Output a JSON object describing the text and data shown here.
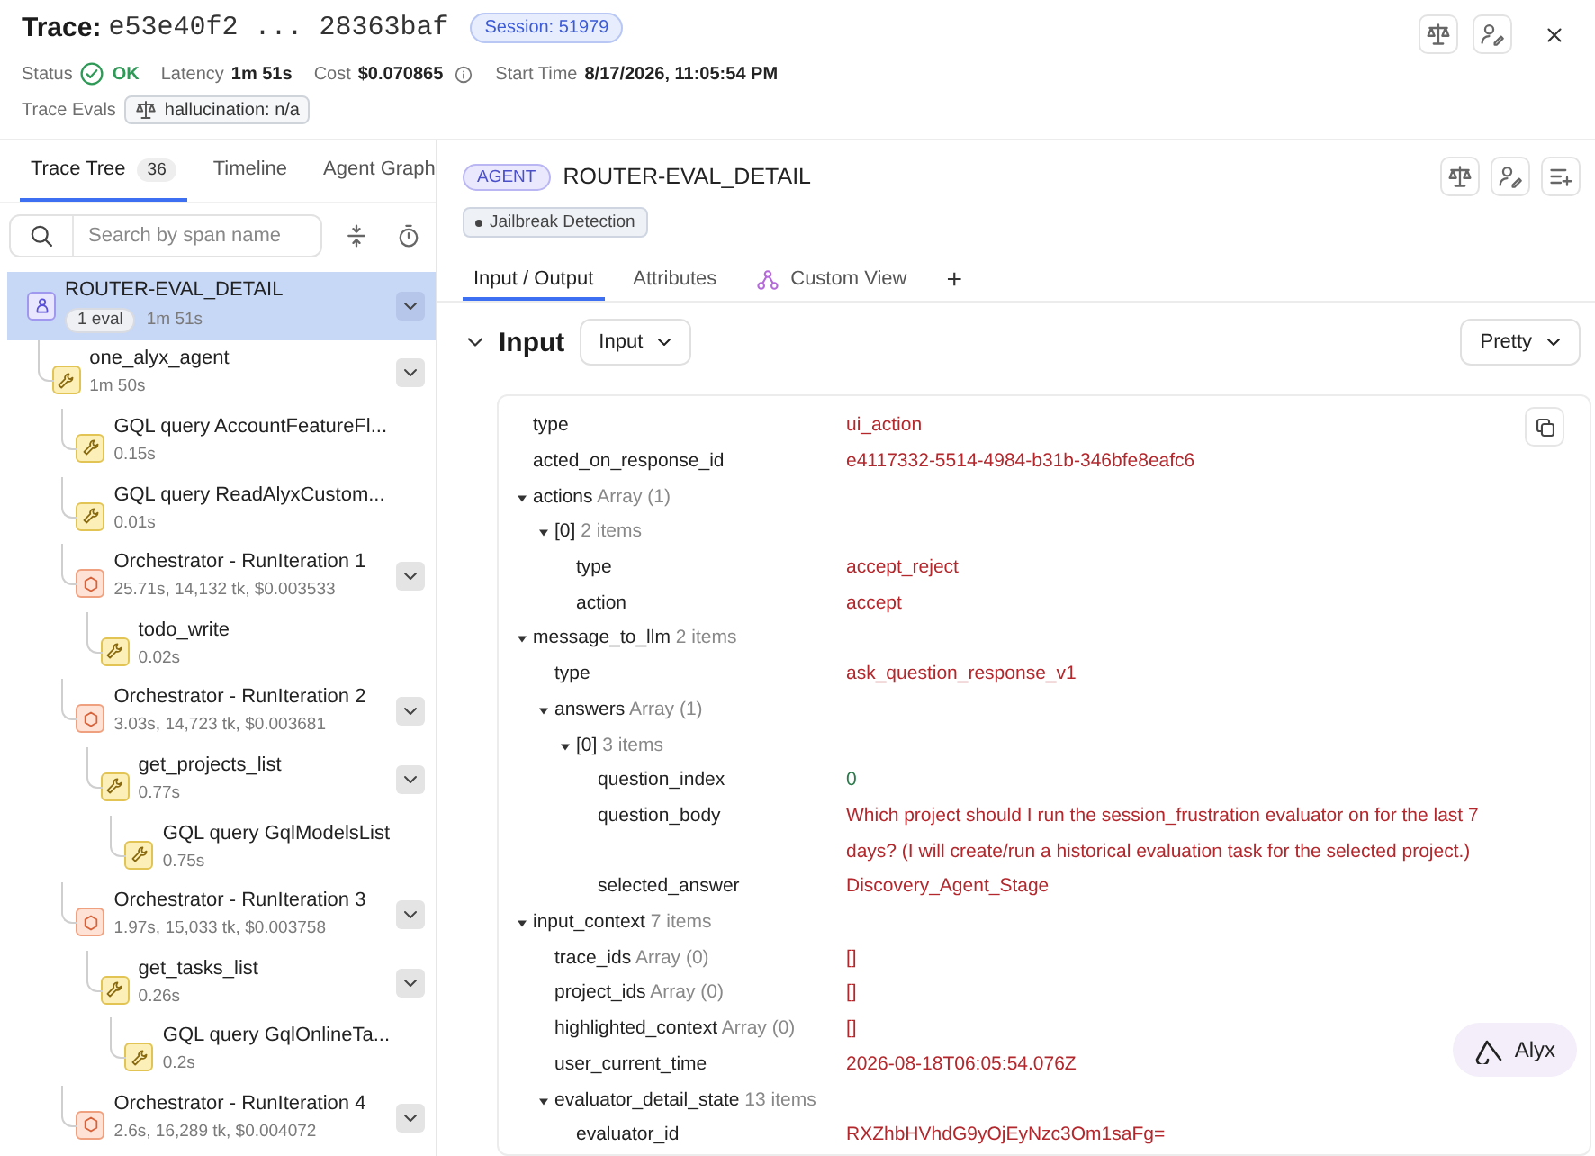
{
  "header": {
    "title_label": "Trace:",
    "trace_id": "e53e40f2 ... 28363baf",
    "session_badge": "Session: 51979",
    "stats": [
      {
        "label": "Status",
        "value": "OK",
        "kind": "status"
      },
      {
        "label": "Latency",
        "value": "1m 51s",
        "kind": "plain"
      },
      {
        "label": "Cost",
        "value": "$0.070865",
        "kind": "info"
      },
      {
        "label": "Start Time",
        "value": "8/17/2026, 11:05:54 PM",
        "kind": "plain"
      }
    ],
    "evals_label": "Trace Evals",
    "eval_badge": "hallucination: n/a"
  },
  "left_panel": {
    "tabs": [
      {
        "label": "Trace Tree",
        "count": "36",
        "selected": true
      },
      {
        "label": "Timeline",
        "selected": false
      },
      {
        "label": "Agent Graph",
        "selected": false
      }
    ],
    "search": {
      "placeholder": "Search by span name"
    },
    "tree": [
      {
        "kind": "agent",
        "name": "ROUTER-EVAL_DETAIL",
        "badge": "1 eval",
        "meta": "1m 51s",
        "selected": true,
        "expanded": true,
        "children": [
          {
            "kind": "tool",
            "name": "one_alyx_agent",
            "meta": "1m 50s",
            "selected": false,
            "expanded": true,
            "children": [
              {
                "kind": "tool",
                "name": "GQL query AccountFeatureFl...",
                "meta": "0.15s",
                "selected": false
              },
              {
                "kind": "tool",
                "name": "GQL query ReadAlyxCustom...",
                "meta": "0.01s",
                "selected": false
              },
              {
                "kind": "chain",
                "name": "Orchestrator - RunIteration 1",
                "meta": "25.71s, 14,132 tk, $0.003533",
                "selected": false,
                "expanded": true,
                "children": [
                  {
                    "kind": "tool",
                    "name": "todo_write",
                    "meta": "0.02s",
                    "selected": false
                  }
                ]
              },
              {
                "kind": "chain",
                "name": "Orchestrator - RunIteration 2",
                "meta": "3.03s, 14,723 tk, $0.003681",
                "selected": false,
                "expanded": true,
                "children": [
                  {
                    "kind": "tool",
                    "name": "get_projects_list",
                    "meta": "0.77s",
                    "selected": false,
                    "expanded": true,
                    "children": [
                      {
                        "kind": "tool",
                        "name": "GQL query GqlModelsList",
                        "meta": "0.75s",
                        "selected": false
                      }
                    ]
                  }
                ]
              },
              {
                "kind": "chain",
                "name": "Orchestrator - RunIteration 3",
                "meta": "1.97s, 15,033 tk, $0.003758",
                "selected": false,
                "expanded": true,
                "children": [
                  {
                    "kind": "tool",
                    "name": "get_tasks_list",
                    "meta": "0.26s",
                    "selected": false,
                    "expanded": true,
                    "children": [
                      {
                        "kind": "tool",
                        "name": "GQL query GqlOnlineTa...",
                        "meta": "0.2s",
                        "selected": false
                      }
                    ]
                  }
                ]
              },
              {
                "kind": "chain",
                "name": "Orchestrator - RunIteration 4",
                "meta": "2.6s, 16,289 tk, $0.004072",
                "selected": false,
                "expanded": true
              }
            ]
          }
        ]
      }
    ]
  },
  "span": {
    "kind_badge": "AGENT",
    "title": "ROUTER-EVAL_DETAIL",
    "tag": "Jailbreak Detection",
    "tabs": [
      {
        "label": "Input / Output",
        "kind": "text",
        "selected": true
      },
      {
        "label": "Attributes",
        "kind": "text",
        "selected": false
      },
      {
        "label": "Custom View",
        "kind": "custom",
        "selected": false
      },
      {
        "label": "+",
        "kind": "add",
        "selected": false
      }
    ],
    "input": {
      "heading": "Input",
      "expanded": true,
      "source_select": "Input",
      "format_select": "Pretty",
      "fields": [
        {
          "key": "type",
          "kind": "string",
          "value": "ui_action"
        },
        {
          "key": "acted_on_response_id",
          "kind": "string",
          "value": "e4117332-5514-4984-b31b-346bfe8eafc6"
        },
        {
          "key": "actions",
          "kind": "object",
          "meta": "Array (1)",
          "expanded": true,
          "children": [
            {
              "key": "[0]",
              "kind": "object",
              "meta": "2 items",
              "expanded": true,
              "children": [
                {
                  "key": "type",
                  "kind": "string",
                  "value": "accept_reject"
                },
                {
                  "key": "action",
                  "kind": "string",
                  "value": "accept"
                }
              ]
            }
          ]
        },
        {
          "key": "message_to_llm",
          "kind": "object",
          "meta": "2 items",
          "expanded": true,
          "children": [
            {
              "key": "type",
              "kind": "string",
              "value": "ask_question_response_v1"
            },
            {
              "key": "answers",
              "kind": "object",
              "meta": "Array (1)",
              "expanded": true,
              "children": [
                {
                  "key": "[0]",
                  "kind": "object",
                  "meta": "3 items",
                  "expanded": true,
                  "children": [
                    {
                      "key": "question_index",
                      "kind": "number",
                      "value": "0"
                    },
                    {
                      "key": "question_body",
                      "kind": "string",
                      "value": "Which project should I run the session_frustration evaluator on for the last 7 days? (I will create/run a historical evaluation task for the selected project.)"
                    },
                    {
                      "key": "selected_answer",
                      "kind": "string",
                      "value": "Discovery_Agent_Stage"
                    }
                  ]
                }
              ]
            }
          ]
        },
        {
          "key": "input_context",
          "kind": "object",
          "meta": "7 items",
          "expanded": true,
          "children": [
            {
              "key": "trace_ids",
              "kind": "string",
              "meta": "Array (0)",
              "value": "[]"
            },
            {
              "key": "project_ids",
              "kind": "string",
              "meta": "Array (0)",
              "value": "[]"
            },
            {
              "key": "highlighted_context",
              "kind": "string",
              "meta": "Array (0)",
              "value": "[]"
            },
            {
              "key": "user_current_time",
              "kind": "string",
              "value": "2026-08-18T06:05:54.076Z"
            },
            {
              "key": "evaluator_detail_state",
              "kind": "object",
              "meta": "13 items",
              "expanded": true,
              "children": [
                {
                  "key": "evaluator_id",
                  "kind": "string",
                  "value": "RXZhbHVhdG9yOjEyNzc3Om1saFg="
                }
              ]
            }
          ]
        }
      ]
    },
    "assistant_button": "Alyx"
  }
}
